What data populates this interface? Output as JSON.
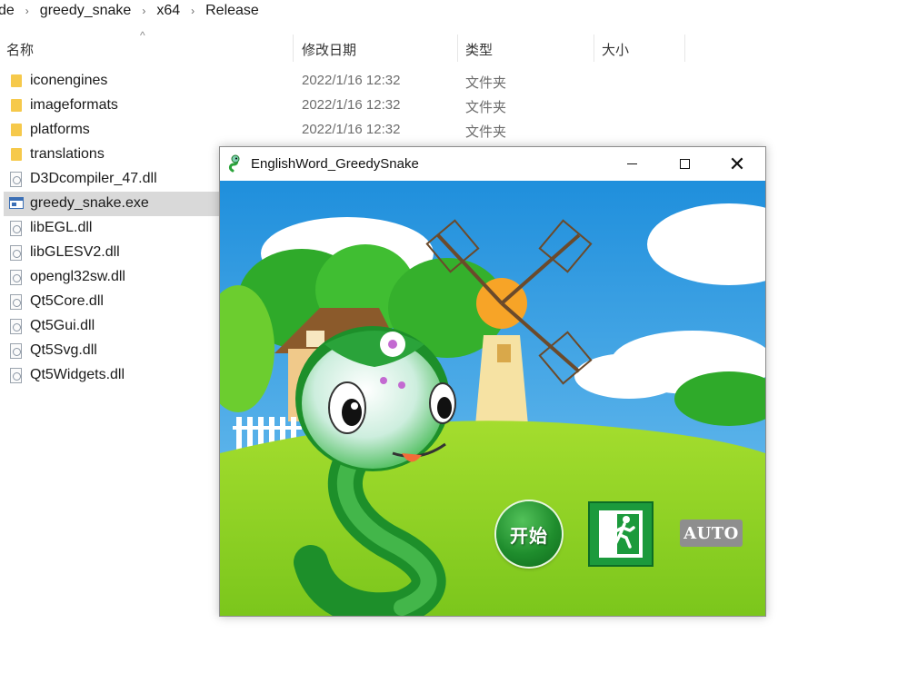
{
  "explorer": {
    "breadcrumb": [
      "de",
      "greedy_snake",
      "x64",
      "Release"
    ],
    "breadcrumb_separator": "›",
    "columns": {
      "name": "名称",
      "date": "修改日期",
      "type": "类型",
      "size": "大小"
    },
    "files": [
      {
        "name": "iconengines",
        "date": "2022/1/16 12:32",
        "type": "文件夹",
        "icon": "folder-icon",
        "selected": false
      },
      {
        "name": "imageformats",
        "date": "2022/1/16 12:32",
        "type": "文件夹",
        "icon": "folder-icon",
        "selected": false
      },
      {
        "name": "platforms",
        "date": "2022/1/16 12:32",
        "type": "文件夹",
        "icon": "folder-icon",
        "selected": false
      },
      {
        "name": "translations",
        "date": "",
        "type": "",
        "icon": "folder-icon",
        "selected": false
      },
      {
        "name": "D3Dcompiler_47.dll",
        "date": "",
        "type": "",
        "icon": "dll-file-icon",
        "selected": false
      },
      {
        "name": "greedy_snake.exe",
        "date": "",
        "type": "",
        "icon": "exe-file-icon",
        "selected": true
      },
      {
        "name": "libEGL.dll",
        "date": "",
        "type": "",
        "icon": "dll-file-icon",
        "selected": false
      },
      {
        "name": "libGLESV2.dll",
        "date": "",
        "type": "",
        "icon": "dll-file-icon",
        "selected": false
      },
      {
        "name": "opengl32sw.dll",
        "date": "",
        "type": "",
        "icon": "dll-file-icon",
        "selected": false
      },
      {
        "name": "Qt5Core.dll",
        "date": "",
        "type": "",
        "icon": "dll-file-icon",
        "selected": false
      },
      {
        "name": "Qt5Gui.dll",
        "date": "",
        "type": "",
        "icon": "dll-file-icon",
        "selected": false
      },
      {
        "name": "Qt5Svg.dll",
        "date": "",
        "type": "",
        "icon": "dll-file-icon",
        "selected": false
      },
      {
        "name": "Qt5Widgets.dll",
        "date": "",
        "type": "",
        "icon": "dll-file-icon",
        "selected": false
      }
    ]
  },
  "game_window": {
    "title": "EnglishWord_GreedySnake",
    "start_button_label": "开始",
    "exit_button_icon": "running-man-exit-icon",
    "auto_button_label": "AUTO"
  },
  "colors": {
    "selection": "#d9d9d9",
    "sky": "#2f9be0",
    "grass": "#8fd428",
    "snake_green": "#2aa33a",
    "start_button": "#1f8d2d",
    "exit_button": "#1c9a3c",
    "auto_button": "#8e8e8e"
  }
}
